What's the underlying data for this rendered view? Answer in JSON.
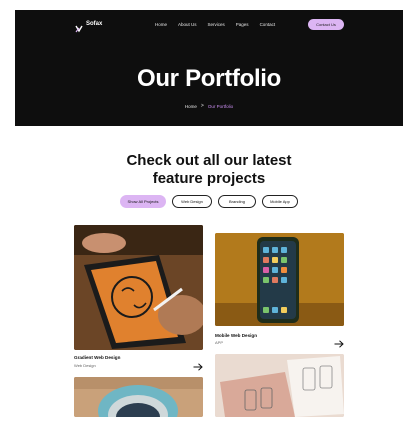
{
  "brand": {
    "name": "Sofax"
  },
  "nav": {
    "links": [
      "Home",
      "About Us",
      "Services",
      "Pages",
      "Contact"
    ],
    "cta_label": "Contact Us"
  },
  "hero": {
    "title": "Our Portfolio",
    "breadcrumb": {
      "home": "Home",
      "separator": ">",
      "current": "Our Portfolio"
    }
  },
  "section": {
    "title_line1": "Check out all our latest",
    "title_line2": "feature projects"
  },
  "filters": [
    "Show All Projects",
    "Web Design",
    "Branding",
    "Mobile App"
  ],
  "projects": [
    {
      "title": "Gradient Web Design",
      "category": "Web Design"
    },
    {
      "title": "Mobile Web Design",
      "category": "APP"
    }
  ],
  "colors": {
    "accent": "#dcb5f3",
    "hero_bg": "#0e0e0e",
    "breadcrumb_active": "#c98ef0"
  }
}
